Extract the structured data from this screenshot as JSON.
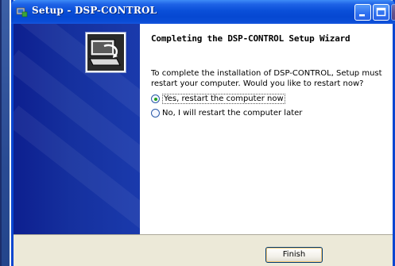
{
  "window": {
    "title": "Setup - DSP-CONTROL"
  },
  "heading": "Completing the DSP-CONTROL Setup Wizard",
  "message": "To complete the installation of DSP-CONTROL, Setup must restart your computer. Would you like to restart now?",
  "options": [
    {
      "label": "Yes, restart the computer now",
      "selected": true
    },
    {
      "label": "No, I will restart the computer later",
      "selected": false
    }
  ],
  "buttons": {
    "finish": "Finish"
  },
  "icons": {
    "title": "setup-icon",
    "minimize": "minimize-icon",
    "maximize": "maximize-icon",
    "close": "close-icon",
    "wizard": "computer-install-icon"
  },
  "colors": {
    "titlebar": "#0a4fd8",
    "wizard_panel": "#15309e",
    "dialog_bg": "#ece9d8"
  }
}
